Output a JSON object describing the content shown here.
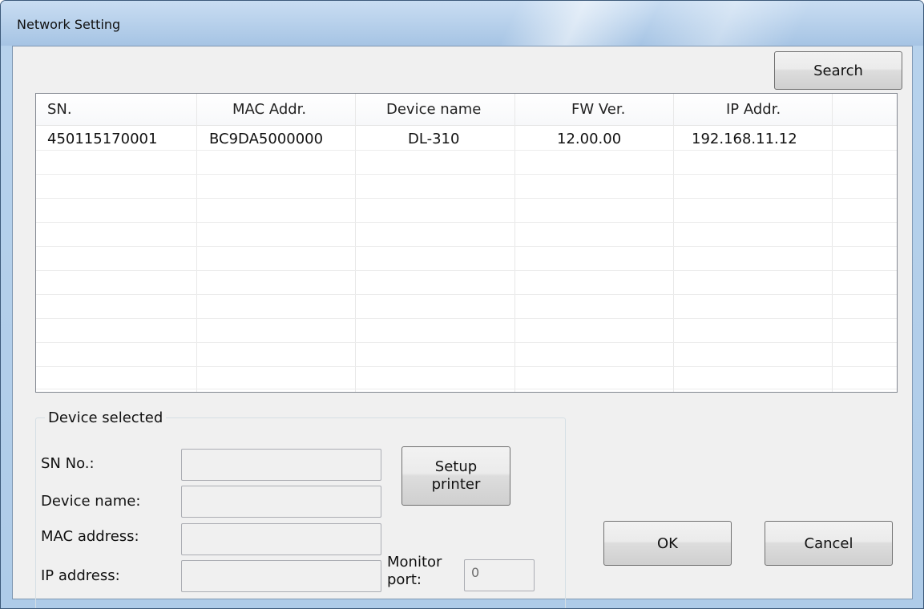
{
  "window": {
    "title": "Network Setting"
  },
  "toolbar": {
    "search_label": "Search"
  },
  "device_list": {
    "columns": [
      "SN.",
      "MAC Addr.",
      "Device name",
      "FW Ver.",
      "IP Addr."
    ],
    "rows": [
      [
        "450115170001",
        "BC9DA5000000",
        "DL-310",
        "12.00.00",
        "192.168.11.12"
      ]
    ]
  },
  "device_selected": {
    "title": "Device selected",
    "sn_label": "SN No.:",
    "sn_value": "",
    "device_name_label": "Device name:",
    "device_name_value": "",
    "mac_label": "MAC address:",
    "mac_value": "",
    "ip_label": "IP address:",
    "ip_value": "",
    "setup_line1": "Setup",
    "setup_line2": "printer",
    "monitor_line1": "Monitor",
    "monitor_line2": "port:",
    "monitor_value": "0"
  },
  "dialog": {
    "ok_label": "OK",
    "cancel_label": "Cancel"
  }
}
